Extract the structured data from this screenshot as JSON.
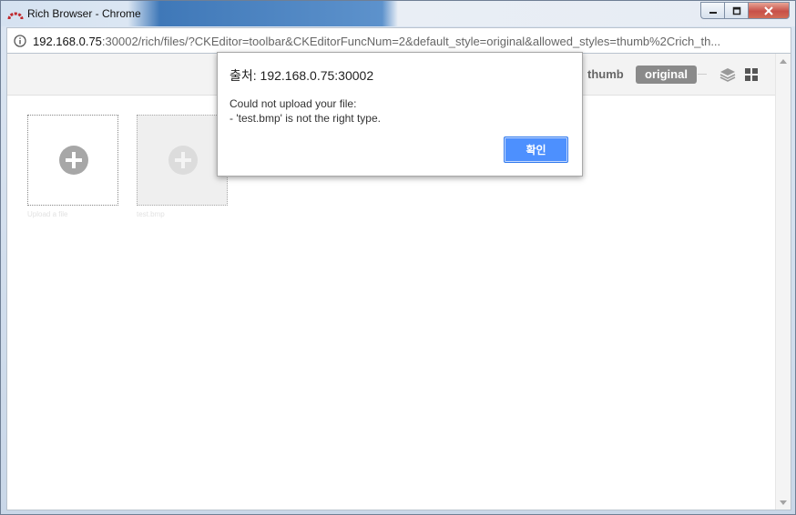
{
  "window": {
    "title": "Rich Browser - Chrome",
    "controls": {
      "minimize": "minimize",
      "maximize": "maximize",
      "close": "close"
    }
  },
  "address_bar": {
    "host": "192.168.0.75",
    "rest": ":30002/rich/files/?CKEditor=toolbar&CKEditorFuncNum=2&default_style=original&allowed_styles=thumb%2Crich_th..."
  },
  "toolbar": {
    "style_options": [
      "thumb",
      "original"
    ],
    "selected_style": "original",
    "icons": [
      "layers-icon",
      "grid-icon"
    ]
  },
  "tiles": [
    {
      "kind": "upload",
      "caption": "Upload a file"
    },
    {
      "kind": "file",
      "caption": "test.bmp"
    }
  ],
  "dialog": {
    "title": "출처: 192.168.0.75:30002",
    "message_line1": "Could not upload your file:",
    "message_line2": "- 'test.bmp' is not the right type.",
    "ok_label": "확인"
  },
  "colors": {
    "accent_button": "#4d90fe",
    "selected_style_bg": "#8a8a8a",
    "titlebar_blue": "#3f78b8"
  }
}
